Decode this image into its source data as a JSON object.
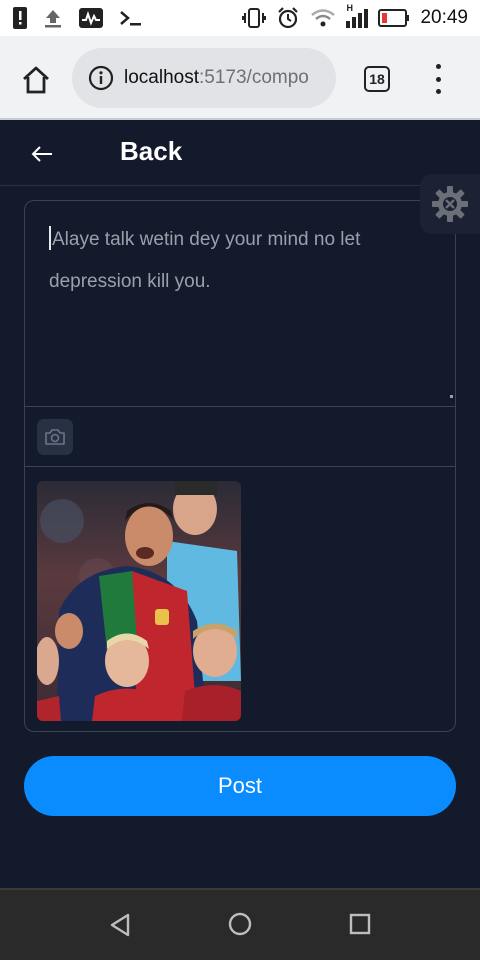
{
  "status_bar": {
    "time": "20:49",
    "icons": [
      "alert-icon",
      "upload-icon",
      "activity-icon",
      "terminal-icon",
      "vibrate-icon",
      "alarm-icon",
      "wifi-icon",
      "signal-icon",
      "battery-icon"
    ],
    "signal_label": "H"
  },
  "browser": {
    "url_host": "localhost",
    "url_path": ":5173/compo",
    "tab_count": "18"
  },
  "header": {
    "back_label": "Back"
  },
  "composer": {
    "text_value": "Alaye talk wetin dey your mind no let depression kill you.",
    "photo_alt": "Attached photo"
  },
  "post_button": {
    "label": "Post"
  },
  "colors": {
    "background": "#131a2b",
    "accent": "#0a8cff",
    "border": "#3b4254"
  }
}
